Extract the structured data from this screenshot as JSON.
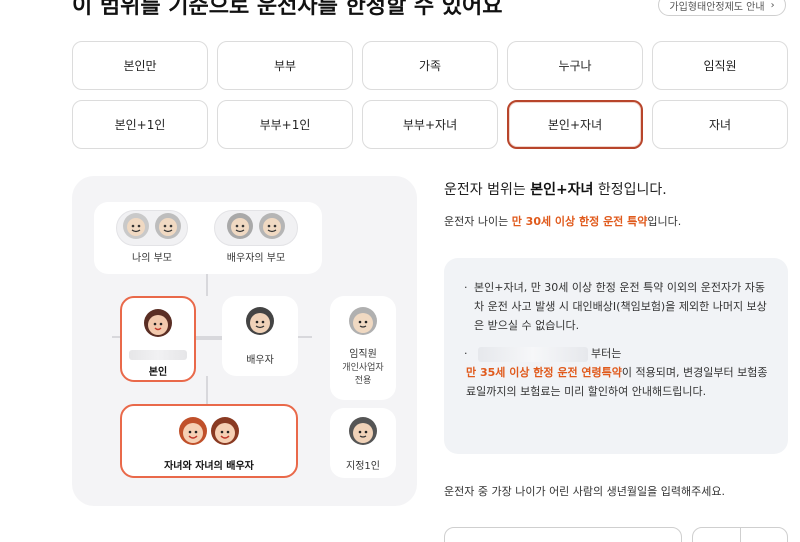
{
  "header": {
    "title": "이 범위를 기준으로 운전자를 한정할 수 있어요",
    "link_label": "가입형태안정제도 안내",
    "link_icon": "chevron-right-icon"
  },
  "options": [
    {
      "label": "본인만",
      "selected": false
    },
    {
      "label": "부부",
      "selected": false
    },
    {
      "label": "가족",
      "selected": false
    },
    {
      "label": "누구나",
      "selected": false
    },
    {
      "label": "임직원",
      "selected": false
    },
    {
      "label": "본인+1인",
      "selected": false
    },
    {
      "label": "부부+1인",
      "selected": false
    },
    {
      "label": "부부+자녀",
      "selected": false
    },
    {
      "label": "본인+자녀",
      "selected": true
    },
    {
      "label": "자녀",
      "selected": false
    }
  ],
  "diagram": {
    "my_parents": "나의 부모",
    "spouse_parents": "배우자의 부모",
    "self": "본인",
    "spouse": "배우자",
    "employee": "임직원",
    "employee_sub1": "개인사업자",
    "employee_sub2": "전용",
    "children": "자녀와 자녀의 배우자",
    "designated": "지정1인"
  },
  "info": {
    "range_prefix": "운전자 범위는 ",
    "range_value": "본인+자녀",
    "range_suffix": " 한정입니다.",
    "age_prefix": "운전자 나이는 ",
    "age_value": "만 30세 이상 한정 운전 특약",
    "age_suffix": "입니다."
  },
  "notice": {
    "bullet1": "본인+자녀, 만 30세 이상 한정 운전 특약 이외의 운전자가 자동차 운전 사고 발생 시 대인배상I(책임보험)을 제외한 나머지 보상은 받으실 수 없습니다.",
    "bullet2_suffix": "부터는",
    "bullet2_highlight": "만 35세 이상 한정 운전 연령특약",
    "bullet2_rest": "이 적용되며, 변경일부터 보험종료일까지의 보험료는 미리 할인하여 안내해드립니다."
  },
  "birth_prompt": "운전자 중 가장 나이가 어린 사람의 생년월일을 입력해주세요.",
  "colors": {
    "accent": "#e05a1c",
    "selected_border": "#b8452b",
    "panel_bg": "#f4f4f6"
  }
}
